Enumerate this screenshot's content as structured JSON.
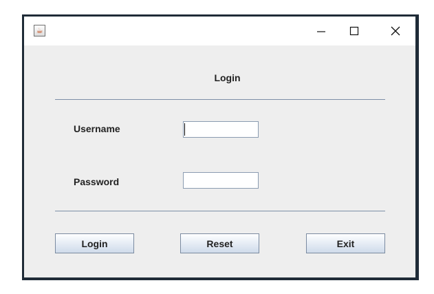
{
  "window": {
    "app_icon_glyph": "☕",
    "controls": {
      "minimize_glyph": "—",
      "maximize_glyph": "□",
      "close_glyph": "✕"
    }
  },
  "form": {
    "title": "Login",
    "username_label": "Username",
    "username_value": "",
    "password_label": "Password",
    "password_value": ""
  },
  "buttons": {
    "login": "Login",
    "reset": "Reset",
    "exit": "Exit"
  },
  "colors": {
    "frame": "#1f2b37",
    "panel": "#eeeeee",
    "separator": "#7c8ea6"
  }
}
